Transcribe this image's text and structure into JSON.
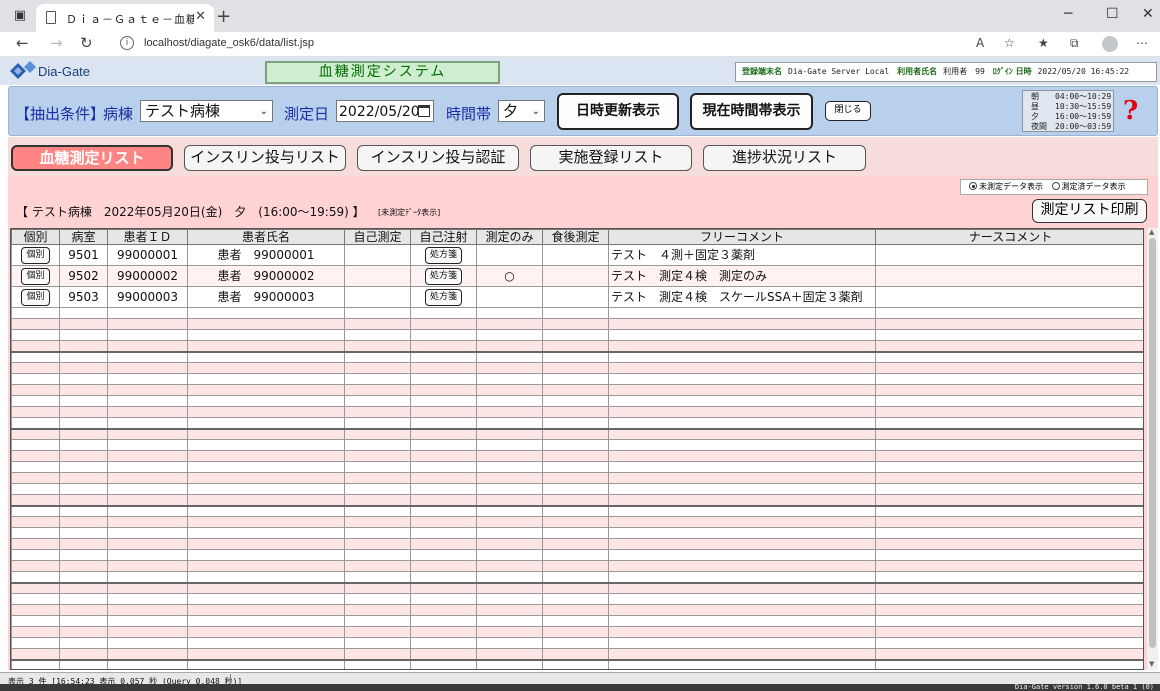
{
  "browser": {
    "tab_title": "Ｄｉａ－Ｇａｔｅ－血糖測定シ",
    "url": "localhost/diagate_osk6/data/list.jsp"
  },
  "header": {
    "logo_text": "Dia-Gate",
    "system_name": "血糖測定システム",
    "terminal_label": "登録端末名",
    "terminal_value": "Dia-Gate Server Local",
    "user_label": "利用者氏名",
    "user_value": "利用者　99",
    "login_label": "ﾛｸﾞｲﾝ 日時",
    "login_value": "2022/05/20 16:45:22"
  },
  "filter": {
    "title": "【抽出条件】",
    "ward_label": "病棟",
    "ward_value": "テスト病棟",
    "date_label": "測定日",
    "date_value": "2022/05/20",
    "time_label": "時間帯",
    "time_value": "夕",
    "refresh_label": "日時更新表示",
    "current_label": "現在時間帯表示",
    "close_label": "閉じる"
  },
  "time_ranges": [
    "朝　　04:00～10:29",
    "昼　　10:30～15:59",
    "夕　　16:00～19:59",
    "夜間　20:00～03:59"
  ],
  "tabs": [
    "血糖測定リスト",
    "インスリン投与リスト",
    "インスリン投与認証",
    "実施登録リスト",
    "進捗状況リスト"
  ],
  "view": {
    "radio_unmeasured": "未測定データ表示",
    "radio_measured": "測定済データ表示",
    "heading": "【 テスト病棟　2022年05月20日(金)　夕　(16:00～19:59) 】",
    "heading_note": "[未測定ﾃﾞｰﾀ表示]",
    "print_label": "測定リスト印刷"
  },
  "table": {
    "columns": [
      "個別",
      "病室",
      "患者ＩＤ",
      "患者氏名",
      "自己測定",
      "自己注射",
      "測定のみ",
      "食後測定",
      "フリーコメント",
      "ナースコメント"
    ],
    "rows": [
      {
        "btn": "個別",
        "room": "9501",
        "id": "99000001",
        "name": "患者　99000001",
        "self_measure": "",
        "inj_btn": "処方箋",
        "measure_only": "",
        "post_meal": "",
        "free": "テスト　４測＋固定３薬剤",
        "nurse": ""
      },
      {
        "btn": "個別",
        "room": "9502",
        "id": "99000002",
        "name": "患者　99000002",
        "self_measure": "",
        "inj_btn": "処方箋",
        "measure_only": "○",
        "post_meal": "",
        "free": "テスト　測定４検　測定のみ",
        "nurse": ""
      },
      {
        "btn": "個別",
        "room": "9503",
        "id": "99000003",
        "name": "患者　99000003",
        "self_measure": "",
        "inj_btn": "処方箋",
        "measure_only": "",
        "post_meal": "",
        "free": "テスト　測定４検　スケールSSA＋固定３薬剤",
        "nurse": ""
      }
    ]
  },
  "status": {
    "left": "表示 3 件 [16:54:23 表示 0.057 秒 (Query 0.048 秒)]",
    "version": "Dia-Gate version 1.6.0 beta 1 (0)"
  }
}
